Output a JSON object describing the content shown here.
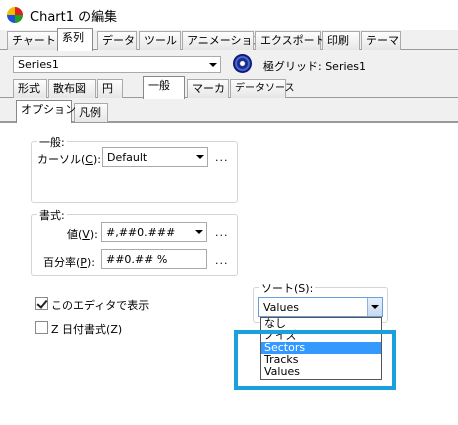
{
  "window": {
    "title": "Chart1 の編集",
    "title_icon": "teechart-icon"
  },
  "top_tabs": [
    {
      "label": "チャート",
      "active": false
    },
    {
      "label": "系列",
      "active": true
    },
    {
      "label": "データ",
      "active": false
    },
    {
      "label": "ツール",
      "active": false
    },
    {
      "label": "アニメーション",
      "active": false
    },
    {
      "label": "エクスポート",
      "active": false
    },
    {
      "label": "印刷",
      "active": false
    },
    {
      "label": "テーマ",
      "active": false
    }
  ],
  "series_bar": {
    "selected": "Series1",
    "series_type_label": "極グリッド: Series1",
    "series_icon": "polar-grid-icon"
  },
  "series_tabs": [
    {
      "label": "形式",
      "active": false
    },
    {
      "label": "散布図",
      "active": false
    },
    {
      "label": "円",
      "active": false
    },
    {
      "label": "一般",
      "active": true
    },
    {
      "label": "マーカ",
      "active": false
    },
    {
      "label": "データソース",
      "active": false
    }
  ],
  "sub_tabs": [
    {
      "label": "オプション",
      "active": true
    },
    {
      "label": "凡例",
      "active": false
    }
  ],
  "general_group": {
    "title": "一般:",
    "cursor_label": "カーソル(",
    "cursor_key": "C",
    "cursor_label_end": "):",
    "cursor_value": "Default",
    "more": "..."
  },
  "format_group": {
    "title": "書式:",
    "value_label": "値(",
    "value_key": "V",
    "value_label_end": "):",
    "value_value": "#,##0.###",
    "percent_label": "百分率(",
    "percent_key": "P",
    "percent_label_end": "):",
    "percent_value": "##0.## %",
    "more": "..."
  },
  "options": {
    "show_in_editor": {
      "label": "このエディタで表示",
      "checked": true
    },
    "z_datetime": {
      "label": "Z 日付書式(Z)",
      "checked": false
    }
  },
  "sort": {
    "label": "ソート(S):",
    "value": "Values",
    "options": [
      "なし",
      "ノイズ",
      "Sectors",
      "Tracks",
      "Values"
    ],
    "highlighted": "Sectors"
  },
  "colors": {
    "highlight_border": "#1aa0dd",
    "selection": "#3399ff"
  }
}
